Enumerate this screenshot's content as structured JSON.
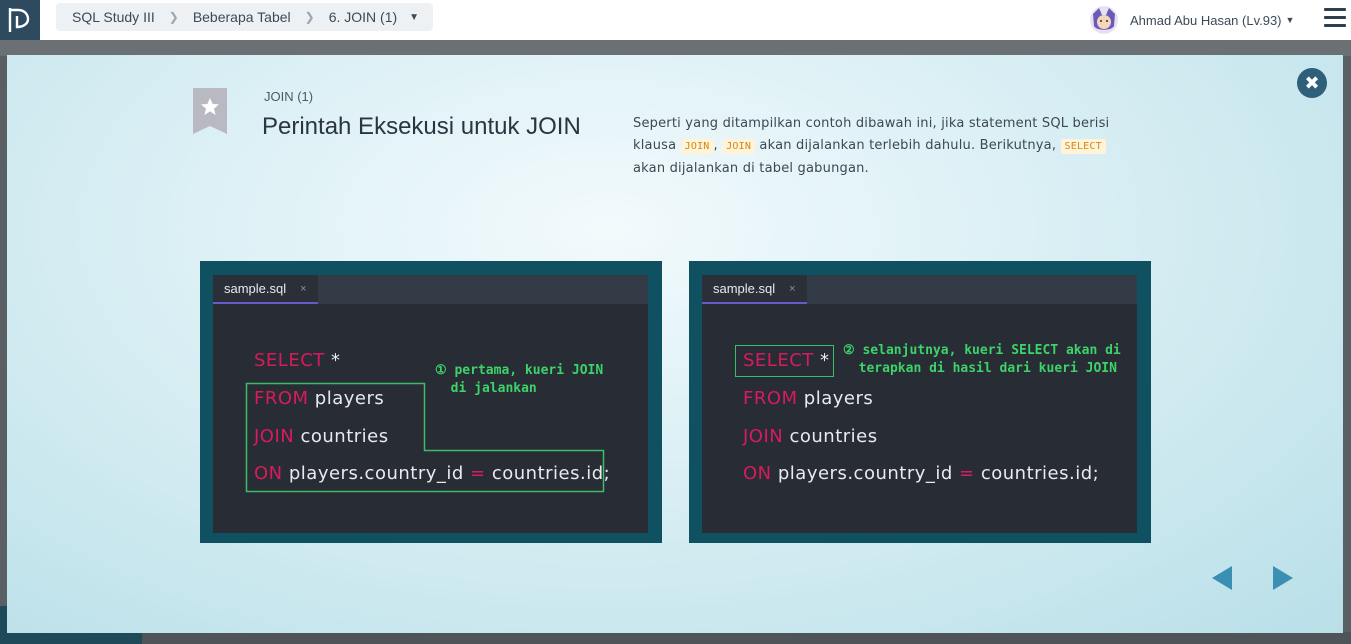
{
  "header": {
    "breadcrumb": [
      "SQL Study III",
      "Beberapa Tabel",
      "6. JOIN (1)"
    ],
    "user_name": "Ahmad Abu Hasan (Lv.93)"
  },
  "slide": {
    "subtitle": "JOIN (1)",
    "title": "Perintah Eksekusi untuk JOIN",
    "desc_part1": "Seperti yang ditampilkan contoh dibawah ini, jika statement SQL berisi klausa ",
    "tag_join_1": "JOIN",
    "desc_comma": ", ",
    "tag_join_2": "JOIN",
    "desc_part2": " akan dijalankan terlebih dahulu. Berikutnya, ",
    "tag_select": "SELECT",
    "desc_part3": " akan dijalankan di tabel gabungan."
  },
  "editors": [
    {
      "tab": "sample.sql",
      "tab_close": "×",
      "lines": [
        {
          "kw": "SELECT",
          "rest": " *"
        },
        {
          "kw": "FROM",
          "rest": " players"
        },
        {
          "kw": "JOIN",
          "rest": " countries"
        },
        {
          "kw": "ON",
          "rest": " players.country_id ",
          "op": "=",
          "rest2": " countries.id;"
        }
      ],
      "note": "① pertama, kueri JOIN\n  di jalankan"
    },
    {
      "tab": "sample.sql",
      "tab_close": "×",
      "lines": [
        {
          "kw": "SELECT",
          "rest": " *"
        },
        {
          "kw": "FROM",
          "rest": " players"
        },
        {
          "kw": "JOIN",
          "rest": " countries"
        },
        {
          "kw": "ON",
          "rest": " players.country_id ",
          "op": "=",
          "rest2": " countries.id;"
        }
      ],
      "note": "② selanjutnya, kueri SELECT akan di\n  terapkan di hasil dari kueri JOIN"
    }
  ],
  "colors": {
    "keyword": "#d81b5c",
    "note": "#3dd36a",
    "panel": "#0f5061",
    "editor_bg": "#282c34"
  },
  "icons": [
    "logo-icon",
    "chevron-right-icon",
    "caret-down-icon",
    "avatar",
    "menu-icon",
    "close-icon",
    "bookmark-icon",
    "prev-arrow-icon",
    "next-arrow-icon"
  ]
}
